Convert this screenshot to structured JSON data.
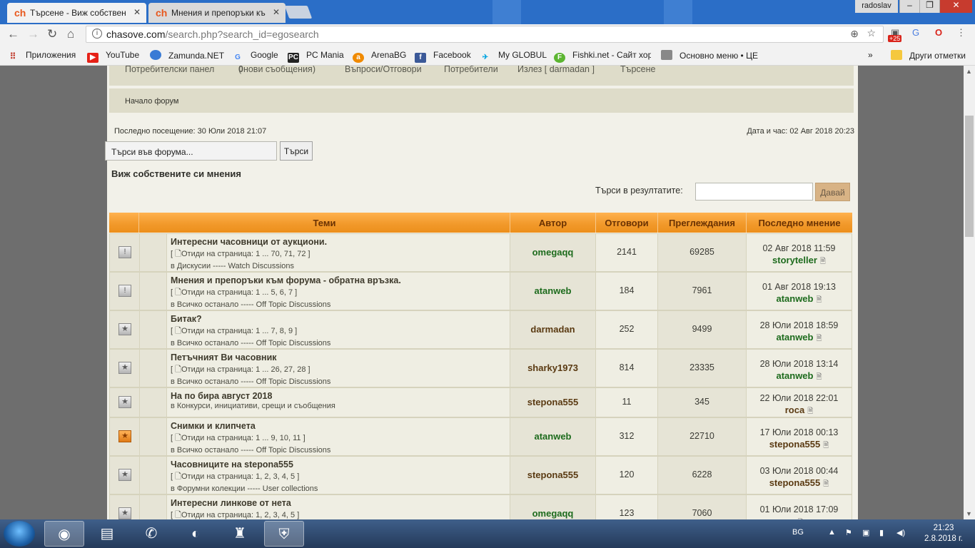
{
  "browser": {
    "tabs": [
      {
        "title": "Търсене - Виж собствен",
        "favicon": "ch"
      },
      {
        "title": "Мнения и препоръки къ",
        "favicon": "ch"
      }
    ],
    "user": "radoslav",
    "url_host": "chasove.com",
    "url_path": "/search.php?search_id=egosearch",
    "ext_badge": "+25",
    "bookmarks": [
      {
        "label": "Приложения",
        "icon": "apps-icon",
        "color": "#c0392b"
      },
      {
        "label": "YouTube",
        "icon": "youtube-icon",
        "color": "#e62117"
      },
      {
        "label": "Zamunda.NET",
        "icon": "zamunda-icon",
        "color": "#3a7bd5"
      },
      {
        "label": "Google",
        "icon": "google-icon",
        "color": "#4285f4"
      },
      {
        "label": "PC Mania",
        "icon": "pcmania-icon",
        "color": "#222222"
      },
      {
        "label": "ArenaBG",
        "icon": "arenabg-icon",
        "color": "#f08a00"
      },
      {
        "label": "Facebook",
        "icon": "facebook-icon",
        "color": "#3b5998"
      },
      {
        "label": "My GLOBUL",
        "icon": "globul-icon",
        "color": "#00a3e0"
      },
      {
        "label": "Fishki.net - Сайт хор",
        "icon": "fishki-icon",
        "color": "#5cb531"
      },
      {
        "label": "Основно меню • ЦЕ",
        "icon": "menu-icon",
        "color": "#888888"
      }
    ],
    "other_bookmarks": "Други отметки"
  },
  "forum": {
    "nav": {
      "panel": "Потребителски панел",
      "messages_open": "(",
      "messages_count": "0",
      "messages_text": " нови съобщения)",
      "faq": "Въпроси/Отговори",
      "users": "Потребители",
      "logout": "Излез [ darmadan ]",
      "search": "Търсене"
    },
    "breadcrumb": "Начало форум",
    "last_visit": "Последно посещение: 30 Юли 2018 21:07",
    "current_time": "Дата и час: 02 Авг 2018 20:23",
    "search_placeholder": "Търси във форума...",
    "search_button": "Търси",
    "page_title": "Виж собствените си мнения",
    "results_label": "Търси в резултатите:",
    "results_button": "Давай",
    "columns": [
      "Теми",
      "Автор",
      "Отговори",
      "Преглеждания",
      "Последно мнение"
    ],
    "topics": [
      {
        "title": "Интересни часовници от аукциони.",
        "pages": "Отиди на страница: 1 ... 70, 71, 72",
        "forum": "в Дискусии ----- Watch Discussions",
        "author": "omegaqq",
        "author_color": "#1d6b1d",
        "replies": "2141",
        "views": "69285",
        "last_date": "02 Авг 2018 11:59",
        "last_user": "storyteller",
        "last_color": "#1d6b1d",
        "icon": "!",
        "hot": false
      },
      {
        "title": "Мнения и препоръки към форума - обратна връзка.",
        "pages": "Отиди на страница: 1 ... 5, 6, 7",
        "forum": "в Всичко останало ----- Off Topic Discussions",
        "author": "atanweb",
        "author_color": "#1d6b1d",
        "replies": "184",
        "views": "7961",
        "last_date": "01 Авг 2018 19:13",
        "last_user": "atanweb",
        "last_color": "#1d6b1d",
        "icon": "!",
        "hot": false
      },
      {
        "title": "Битак?",
        "pages": "Отиди на страница: 1 ... 7, 8, 9",
        "forum": "в Всичко останало ----- Off Topic Discussions",
        "author": "darmadan",
        "author_color": "#5a3a12",
        "replies": "252",
        "views": "9499",
        "last_date": "28 Юли 2018 18:59",
        "last_user": "atanweb",
        "last_color": "#1d6b1d",
        "icon": "★",
        "hot": false
      },
      {
        "title": "Петъчният Ви часовник",
        "pages": "Отиди на страница: 1 ... 26, 27, 28",
        "forum": "в Всичко останало ----- Off Topic Discussions",
        "author": "sharky1973",
        "author_color": "#5a3a12",
        "replies": "814",
        "views": "23335",
        "last_date": "28 Юли 2018 13:14",
        "last_user": "atanweb",
        "last_color": "#1d6b1d",
        "icon": "★",
        "hot": false
      },
      {
        "title": "На по бира август 2018",
        "pages": "",
        "forum": "в Конкурси, инициативи, срещи и съобщения",
        "author": "stepona555",
        "author_color": "#5a3a12",
        "replies": "11",
        "views": "345",
        "last_date": "22 Юли 2018 22:01",
        "last_user": "roca",
        "last_color": "#5a3a12",
        "icon": "★",
        "hot": false
      },
      {
        "title": "Снимки и клипчета",
        "pages": "Отиди на страница: 1 ... 9, 10, 11",
        "forum": "в Всичко останало ----- Off Topic Discussions",
        "author": "atanweb",
        "author_color": "#1d6b1d",
        "replies": "312",
        "views": "22710",
        "last_date": "17 Юли 2018 00:13",
        "last_user": "stepona555",
        "last_color": "#5a3a12",
        "icon": "★",
        "hot": true
      },
      {
        "title": "Часовниците на stepona555",
        "pages": "Отиди на страница: 1, 2, 3, 4, 5",
        "forum": "в Форумни колекции ----- User collections",
        "author": "stepona555",
        "author_color": "#5a3a12",
        "replies": "120",
        "views": "6228",
        "last_date": "03 Юли 2018 00:44",
        "last_user": "stepona555",
        "last_color": "#5a3a12",
        "icon": "★",
        "hot": false
      },
      {
        "title": "Интересни линкове от нета",
        "pages": "Отиди на страница: 1, 2, 3, 4, 5",
        "forum": "",
        "author": "omegaqq",
        "author_color": "#1d6b1d",
        "replies": "123",
        "views": "7060",
        "last_date": "01 Юли 2018 17:09",
        "last_user": "",
        "last_color": "#1d6b1d",
        "icon": "★",
        "hot": false
      }
    ]
  },
  "taskbar": {
    "lang": "BG",
    "time": "21:23",
    "date": "2.8.2018 г."
  }
}
